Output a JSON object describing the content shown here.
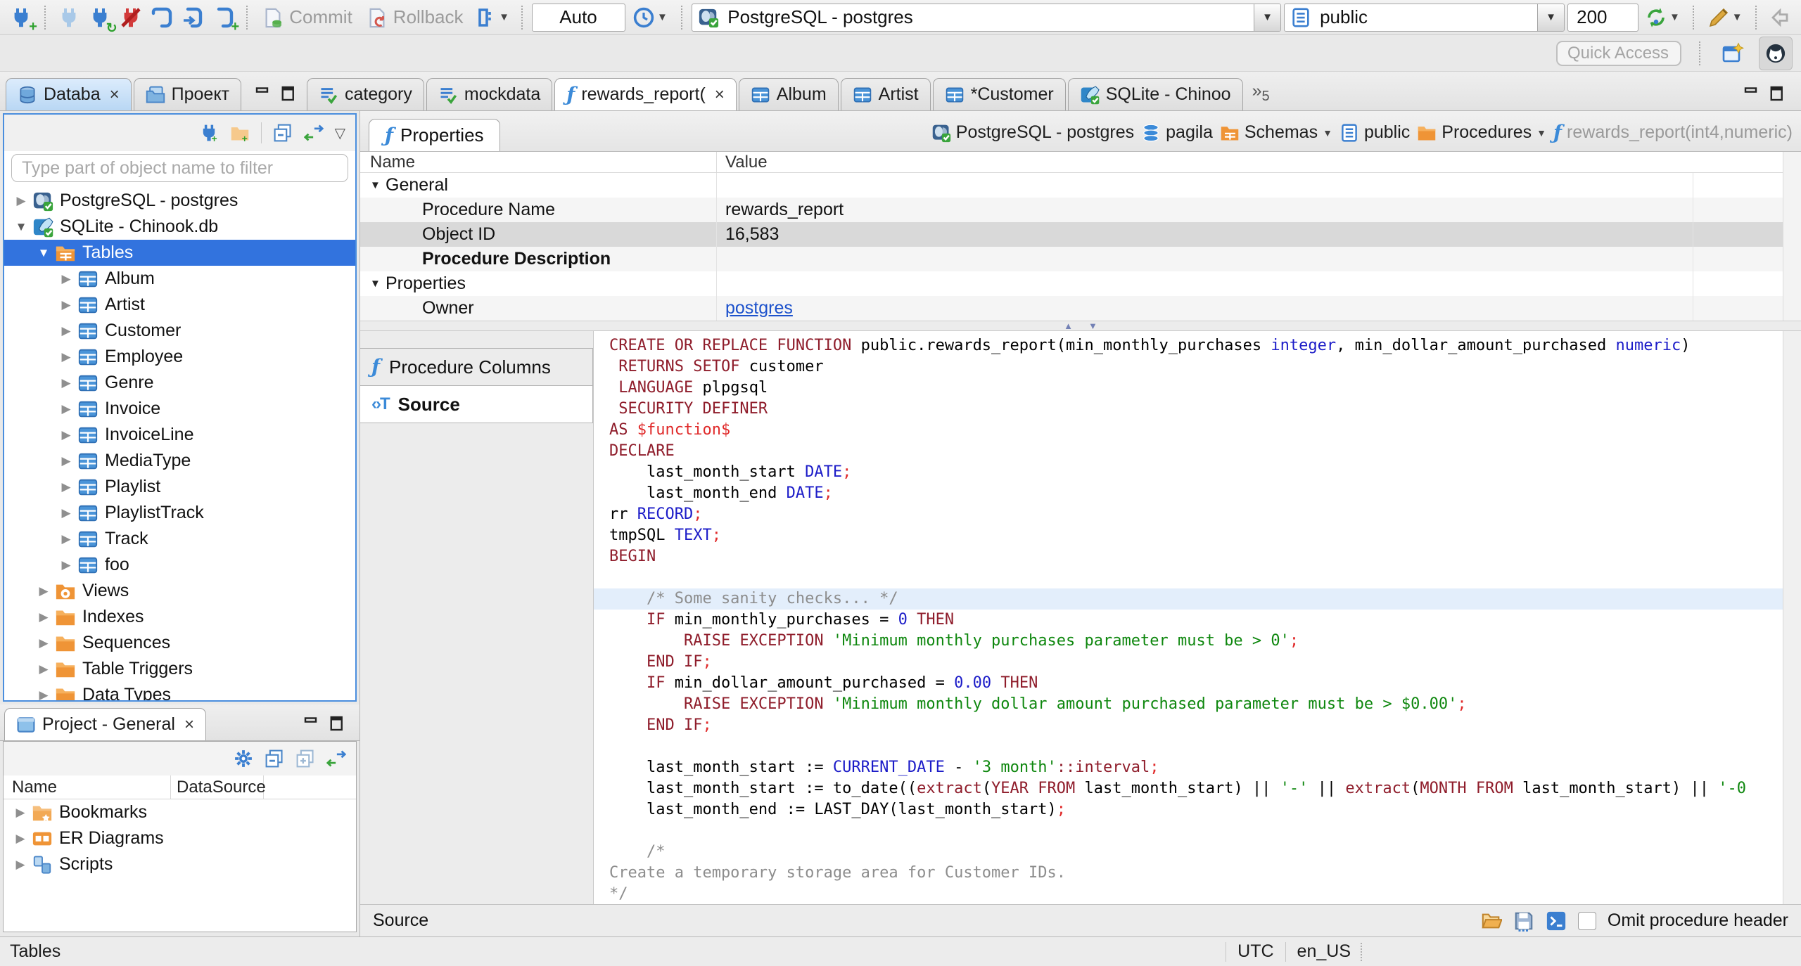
{
  "toolbar": {
    "commit": "Commit",
    "rollback": "Rollback",
    "auto": "Auto",
    "connection": "PostgreSQL - postgres",
    "schema": "public",
    "fetch_size": "200",
    "quick_access": "Quick Access"
  },
  "tabs": {
    "left": [
      {
        "label": "Databa",
        "icon": "db-navigator",
        "active": true,
        "closable": true
      },
      {
        "label": "Проект",
        "icon": "projects"
      }
    ],
    "editor": [
      {
        "label": "category",
        "icon": "script"
      },
      {
        "label": "mockdata",
        "icon": "script"
      },
      {
        "label": "rewards_report(",
        "icon": "function",
        "active": true,
        "closable": true
      },
      {
        "label": "Album",
        "icon": "table"
      },
      {
        "label": "Artist",
        "icon": "table"
      },
      {
        "label": "*Customer",
        "icon": "table"
      },
      {
        "label": "SQLite - Chinoo",
        "icon": "sqlite"
      }
    ],
    "overflow_count": "5"
  },
  "navigator": {
    "filter_placeholder": "Type part of object name to filter",
    "tree": [
      {
        "label": "PostgreSQL - postgres",
        "icon": "postgres",
        "state": "collapsed",
        "indent": 0
      },
      {
        "label": "SQLite - Chinook.db",
        "icon": "sqlite",
        "state": "expanded",
        "indent": 0
      },
      {
        "label": "Tables",
        "icon": "tables-folder",
        "state": "expanded",
        "indent": 1,
        "selected": true
      },
      {
        "label": "Album",
        "icon": "table",
        "state": "collapsed",
        "indent": 2
      },
      {
        "label": "Artist",
        "icon": "table",
        "state": "collapsed",
        "indent": 2
      },
      {
        "label": "Customer",
        "icon": "table",
        "state": "collapsed",
        "indent": 2
      },
      {
        "label": "Employee",
        "icon": "table",
        "state": "collapsed",
        "indent": 2
      },
      {
        "label": "Genre",
        "icon": "table",
        "state": "collapsed",
        "indent": 2
      },
      {
        "label": "Invoice",
        "icon": "table",
        "state": "collapsed",
        "indent": 2
      },
      {
        "label": "InvoiceLine",
        "icon": "table",
        "state": "collapsed",
        "indent": 2
      },
      {
        "label": "MediaType",
        "icon": "table",
        "state": "collapsed",
        "indent": 2
      },
      {
        "label": "Playlist",
        "icon": "table",
        "state": "collapsed",
        "indent": 2
      },
      {
        "label": "PlaylistTrack",
        "icon": "table",
        "state": "collapsed",
        "indent": 2
      },
      {
        "label": "Track",
        "icon": "table",
        "state": "collapsed",
        "indent": 2
      },
      {
        "label": "foo",
        "icon": "table",
        "state": "collapsed",
        "indent": 2
      },
      {
        "label": "Views",
        "icon": "views-folder",
        "state": "collapsed",
        "indent": 1
      },
      {
        "label": "Indexes",
        "icon": "folder",
        "state": "collapsed",
        "indent": 1
      },
      {
        "label": "Sequences",
        "icon": "folder",
        "state": "collapsed",
        "indent": 1
      },
      {
        "label": "Table Triggers",
        "icon": "folder",
        "state": "collapsed",
        "indent": 1
      },
      {
        "label": "Data Types",
        "icon": "folder",
        "state": "collapsed",
        "indent": 1
      }
    ]
  },
  "project_panel": {
    "title": "Project - General",
    "columns": [
      "Name",
      "DataSource"
    ],
    "items": [
      {
        "label": "Bookmarks",
        "icon": "bookmarks-folder"
      },
      {
        "label": "ER Diagrams",
        "icon": "er-diagrams"
      },
      {
        "label": "Scripts",
        "icon": "scripts"
      }
    ]
  },
  "object_editor": {
    "tab": "Properties",
    "breadcrumbs": [
      {
        "label": "PostgreSQL - postgres",
        "icon": "postgres"
      },
      {
        "label": "pagila",
        "icon": "database"
      },
      {
        "label": "Schemas",
        "icon": "schemas-folder",
        "dropdown": true
      },
      {
        "label": "public",
        "icon": "schema-page"
      },
      {
        "label": "Procedures",
        "icon": "folder",
        "dropdown": true
      },
      {
        "label": "rewards_report(int4,numeric)",
        "icon": "function",
        "muted": true
      }
    ],
    "properties": {
      "columns": [
        "Name",
        "Value"
      ],
      "rows": [
        {
          "name": "General",
          "type": "group"
        },
        {
          "name": "Procedure Name",
          "value": "rewards_report",
          "stripe": true
        },
        {
          "name": "Object ID",
          "value": "16,583",
          "selected": true
        },
        {
          "name": "Procedure Description",
          "bold": true,
          "stripe": true
        },
        {
          "name": "Properties",
          "type": "group"
        },
        {
          "name": "Owner",
          "value": "postgres",
          "link": true,
          "stripe": true
        }
      ]
    },
    "subtabs": [
      {
        "label": "Procedure Columns",
        "icon": "function"
      },
      {
        "label": "Source",
        "icon": "source",
        "active": true
      }
    ],
    "footer": {
      "label": "Source",
      "omit_checkbox": "Omit procedure header"
    }
  },
  "source_code": {
    "lines": [
      {
        "seg": [
          [
            "kw",
            "CREATE OR REPLACE FUNCTION "
          ],
          [
            "pl",
            "public.rewards_report(min_monthly_purchases "
          ],
          [
            "ty",
            "integer"
          ],
          [
            "pl",
            ", min_dollar_amount_purchased "
          ],
          [
            "ty",
            "numeric"
          ],
          [
            "pl",
            ")"
          ]
        ]
      },
      {
        "seg": [
          [
            "pl",
            " "
          ],
          [
            "kw",
            "RETURNS SETOF "
          ],
          [
            "pl",
            "customer"
          ]
        ]
      },
      {
        "seg": [
          [
            "pl",
            " "
          ],
          [
            "kw",
            "LANGUAGE "
          ],
          [
            "pl",
            "plpgsql"
          ]
        ]
      },
      {
        "seg": [
          [
            "pl",
            " "
          ],
          [
            "kw",
            "SECURITY DEFINER"
          ]
        ]
      },
      {
        "seg": [
          [
            "kw",
            "AS "
          ],
          [
            "dd",
            "$function$"
          ]
        ]
      },
      {
        "seg": [
          [
            "kw",
            "DECLARE"
          ]
        ]
      },
      {
        "seg": [
          [
            "pl",
            "    last_month_start "
          ],
          [
            "ty",
            "DATE"
          ],
          [
            "dd",
            ";"
          ]
        ]
      },
      {
        "seg": [
          [
            "pl",
            "    last_month_end "
          ],
          [
            "ty",
            "DATE"
          ],
          [
            "dd",
            ";"
          ]
        ]
      },
      {
        "seg": [
          [
            "pl",
            "rr "
          ],
          [
            "ty",
            "RECORD"
          ],
          [
            "dd",
            ";"
          ]
        ]
      },
      {
        "seg": [
          [
            "pl",
            "tmpSQL "
          ],
          [
            "ty",
            "TEXT"
          ],
          [
            "dd",
            ";"
          ]
        ]
      },
      {
        "seg": [
          [
            "kw",
            "BEGIN"
          ]
        ]
      },
      {
        "seg": []
      },
      {
        "hl": true,
        "seg": [
          [
            "cm",
            "    /* Some sanity checks... */"
          ]
        ]
      },
      {
        "seg": [
          [
            "pl",
            "    "
          ],
          [
            "kw",
            "IF"
          ],
          [
            "pl",
            " min_monthly_purchases = "
          ],
          [
            "ty",
            "0"
          ],
          [
            "pl",
            " "
          ],
          [
            "kw",
            "THEN"
          ]
        ]
      },
      {
        "seg": [
          [
            "pl",
            "        "
          ],
          [
            "kw",
            "RAISE EXCEPTION "
          ],
          [
            "st",
            "'Minimum monthly purchases parameter must be > 0'"
          ],
          [
            "dd",
            ";"
          ]
        ]
      },
      {
        "seg": [
          [
            "pl",
            "    "
          ],
          [
            "kw",
            "END IF"
          ],
          [
            "dd",
            ";"
          ]
        ]
      },
      {
        "seg": [
          [
            "pl",
            "    "
          ],
          [
            "kw",
            "IF"
          ],
          [
            "pl",
            " min_dollar_amount_purchased = "
          ],
          [
            "ty",
            "0.00"
          ],
          [
            "pl",
            " "
          ],
          [
            "kw",
            "THEN"
          ]
        ]
      },
      {
        "seg": [
          [
            "pl",
            "        "
          ],
          [
            "kw",
            "RAISE EXCEPTION "
          ],
          [
            "st",
            "'Minimum monthly dollar amount purchased parameter must be > $0.00'"
          ],
          [
            "dd",
            ";"
          ]
        ]
      },
      {
        "seg": [
          [
            "pl",
            "    "
          ],
          [
            "kw",
            "END IF"
          ],
          [
            "dd",
            ";"
          ]
        ]
      },
      {
        "seg": []
      },
      {
        "seg": [
          [
            "pl",
            "    last_month_start := "
          ],
          [
            "ty",
            "CURRENT_DATE"
          ],
          [
            "pl",
            " - "
          ],
          [
            "st",
            "'3 month'"
          ],
          [
            "kw",
            "::interval"
          ],
          [
            "dd",
            ";"
          ]
        ]
      },
      {
        "seg": [
          [
            "pl",
            "    last_month_start := to_date(("
          ],
          [
            "kw",
            "extract"
          ],
          [
            "pl",
            "("
          ],
          [
            "kw",
            "YEAR FROM"
          ],
          [
            "pl",
            " last_month_start) || "
          ],
          [
            "st",
            "'-'"
          ],
          [
            "pl",
            " || "
          ],
          [
            "kw",
            "extract"
          ],
          [
            "pl",
            "("
          ],
          [
            "kw",
            "MONTH FROM"
          ],
          [
            "pl",
            " last_month_start) || "
          ],
          [
            "st",
            "'-0"
          ]
        ]
      },
      {
        "seg": [
          [
            "pl",
            "    last_month_end := LAST_DAY(last_month_start)"
          ],
          [
            "dd",
            ";"
          ]
        ]
      },
      {
        "seg": []
      },
      {
        "seg": [
          [
            "cm",
            "    /*"
          ]
        ]
      },
      {
        "seg": [
          [
            "cm",
            "Create a temporary storage area for Customer IDs."
          ]
        ]
      },
      {
        "seg": [
          [
            "cm",
            "*/"
          ]
        ]
      }
    ]
  },
  "statusbar": {
    "left": "Tables",
    "timezone": "UTC",
    "locale": "en_US"
  }
}
